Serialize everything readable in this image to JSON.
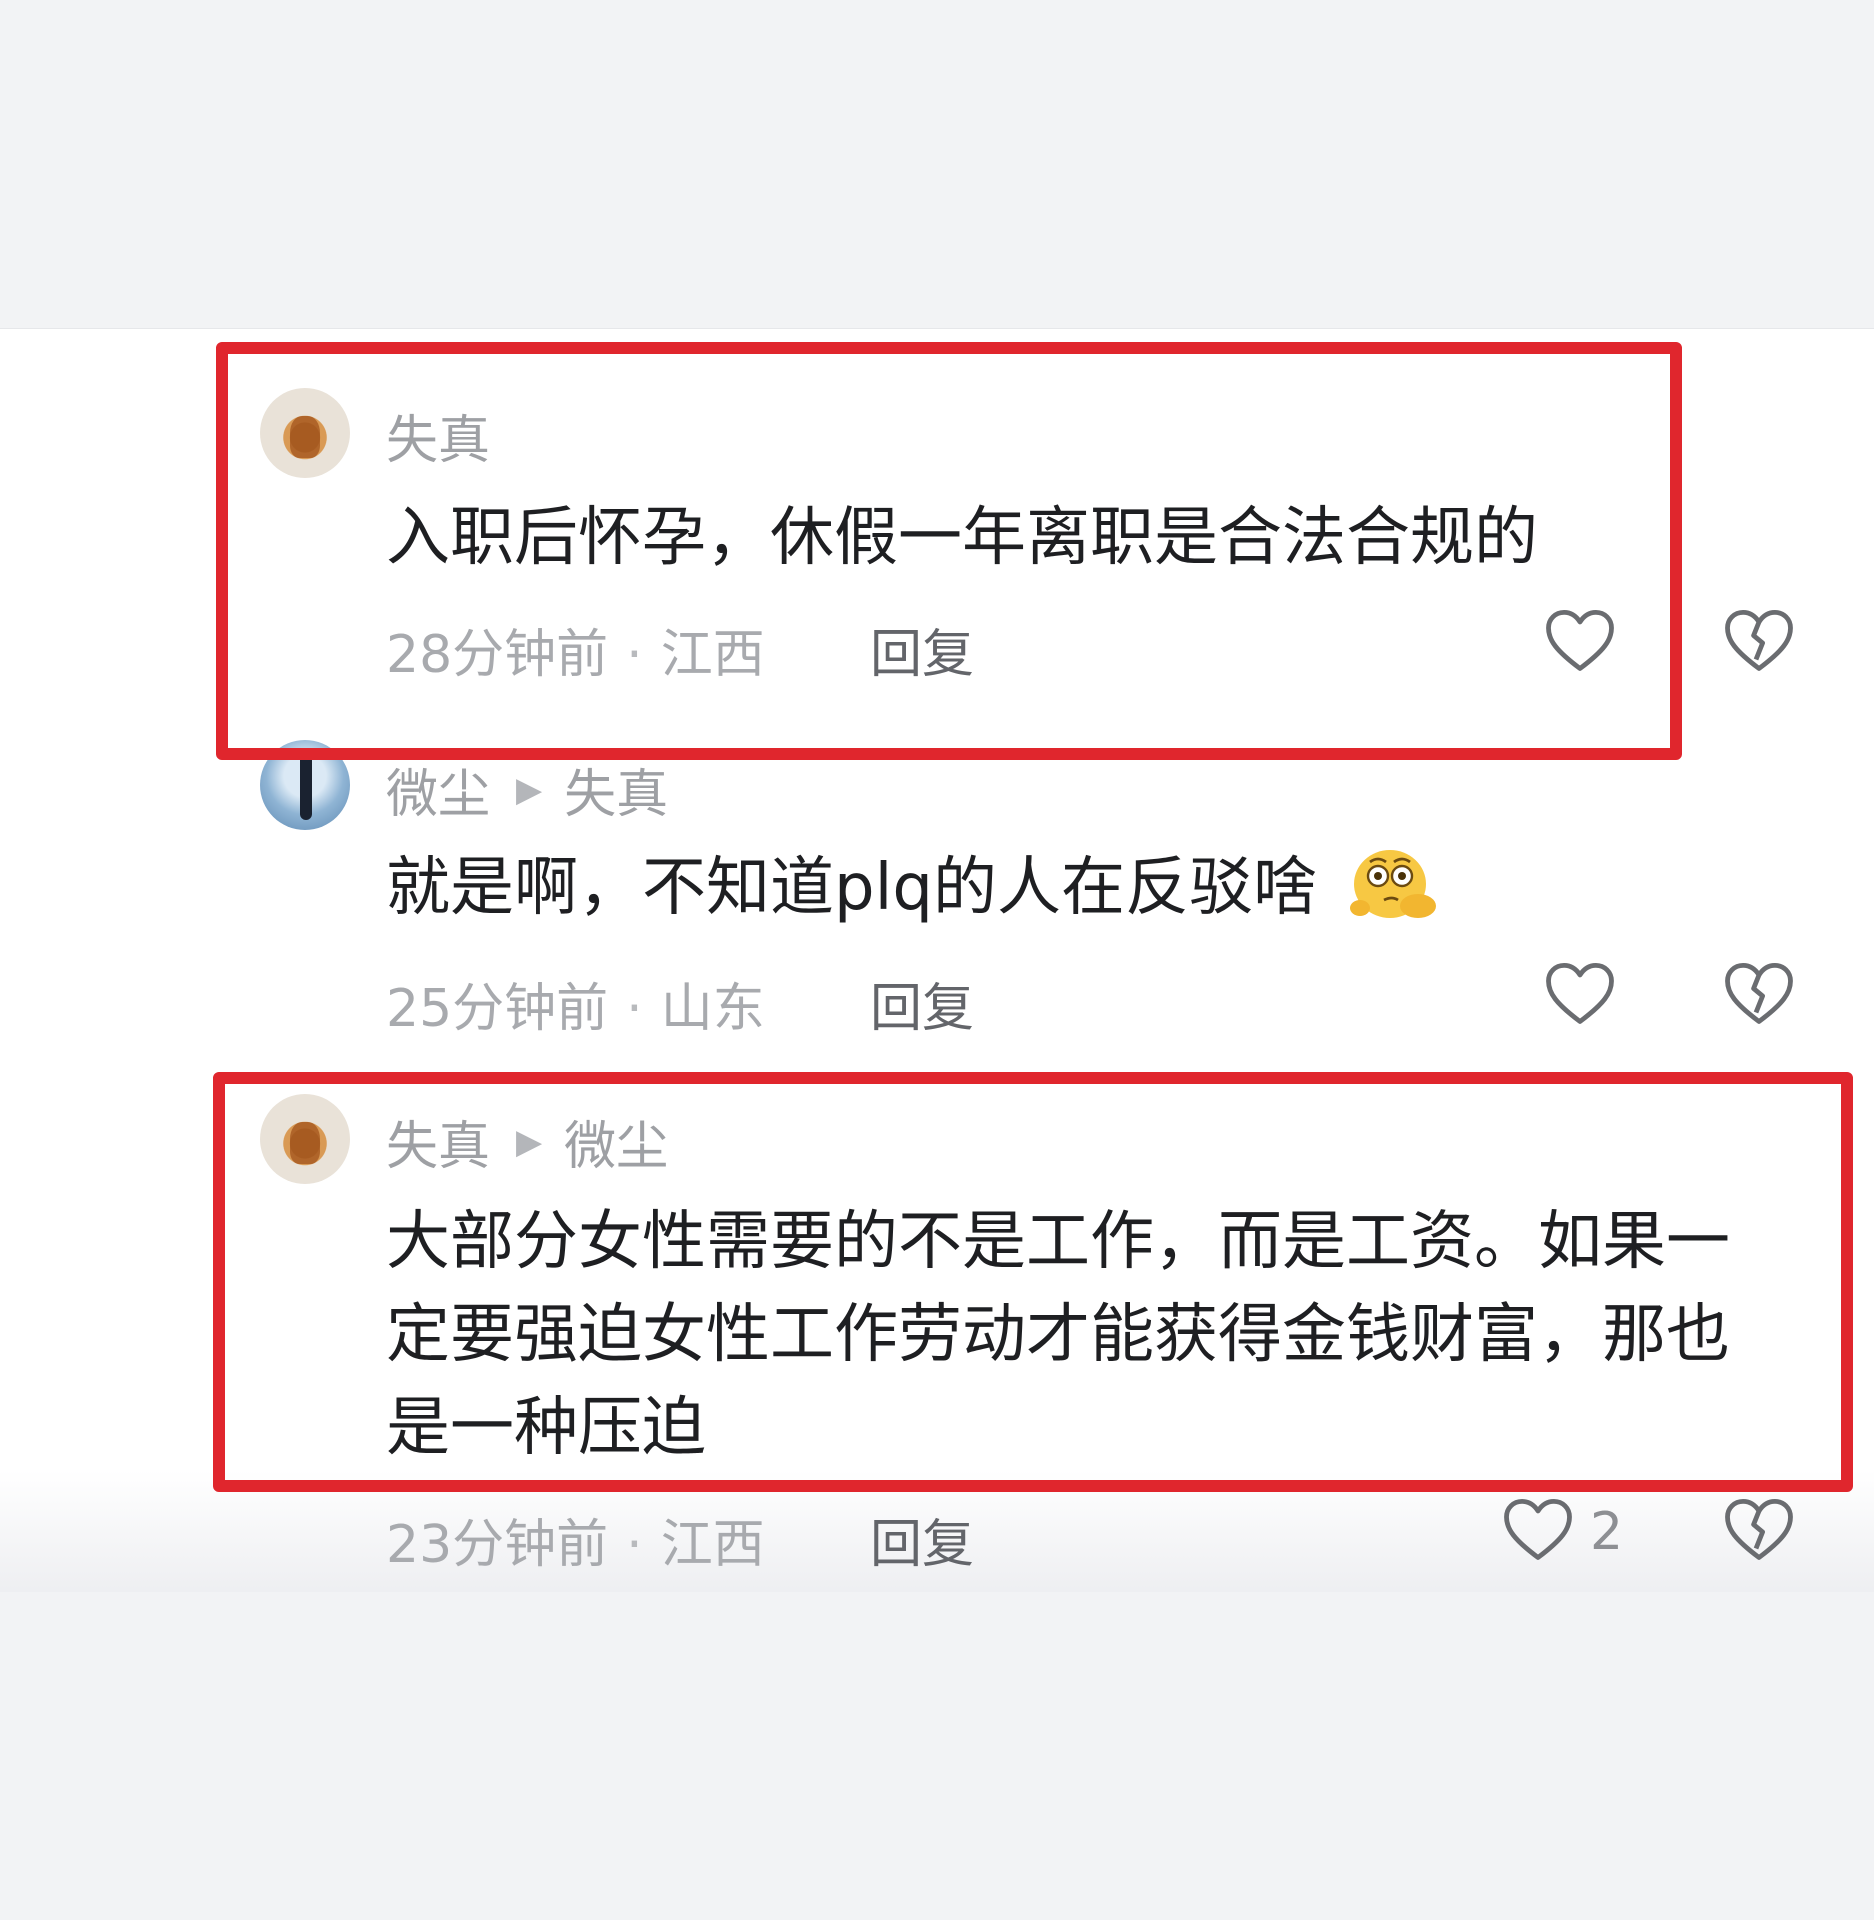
{
  "comments": [
    {
      "author": "失真",
      "text": "入职后怀孕，休假一年离职是合法合规的",
      "time": "28分钟前",
      "location": "江西",
      "reply_label": "回复"
    },
    {
      "author": "微尘",
      "reply_to": "失真",
      "text": "就是啊，不知道plq的人在反驳啥",
      "emoji_icon": "thinking-face-emoji",
      "time": "25分钟前",
      "location": "山东",
      "reply_label": "回复"
    },
    {
      "author": "失真",
      "reply_to": "微尘",
      "text_lines": [
        "大部分女性需要的不是工作，而是工资。如果一",
        "定要强迫女性工作劳动才能获得金钱财富，那也",
        "是一种压迫"
      ],
      "time": "23分钟前",
      "location": "江西",
      "reply_label": "回复",
      "like_count": "2"
    }
  ],
  "icons": {
    "like": "heart-outline-icon",
    "dislike": "broken-heart-icon",
    "reply_arrow": "play-triangle-icon"
  },
  "colors": {
    "highlight_box": "#e0262d",
    "meta_text": "#a8aaae",
    "body_text": "#1e1f22"
  }
}
